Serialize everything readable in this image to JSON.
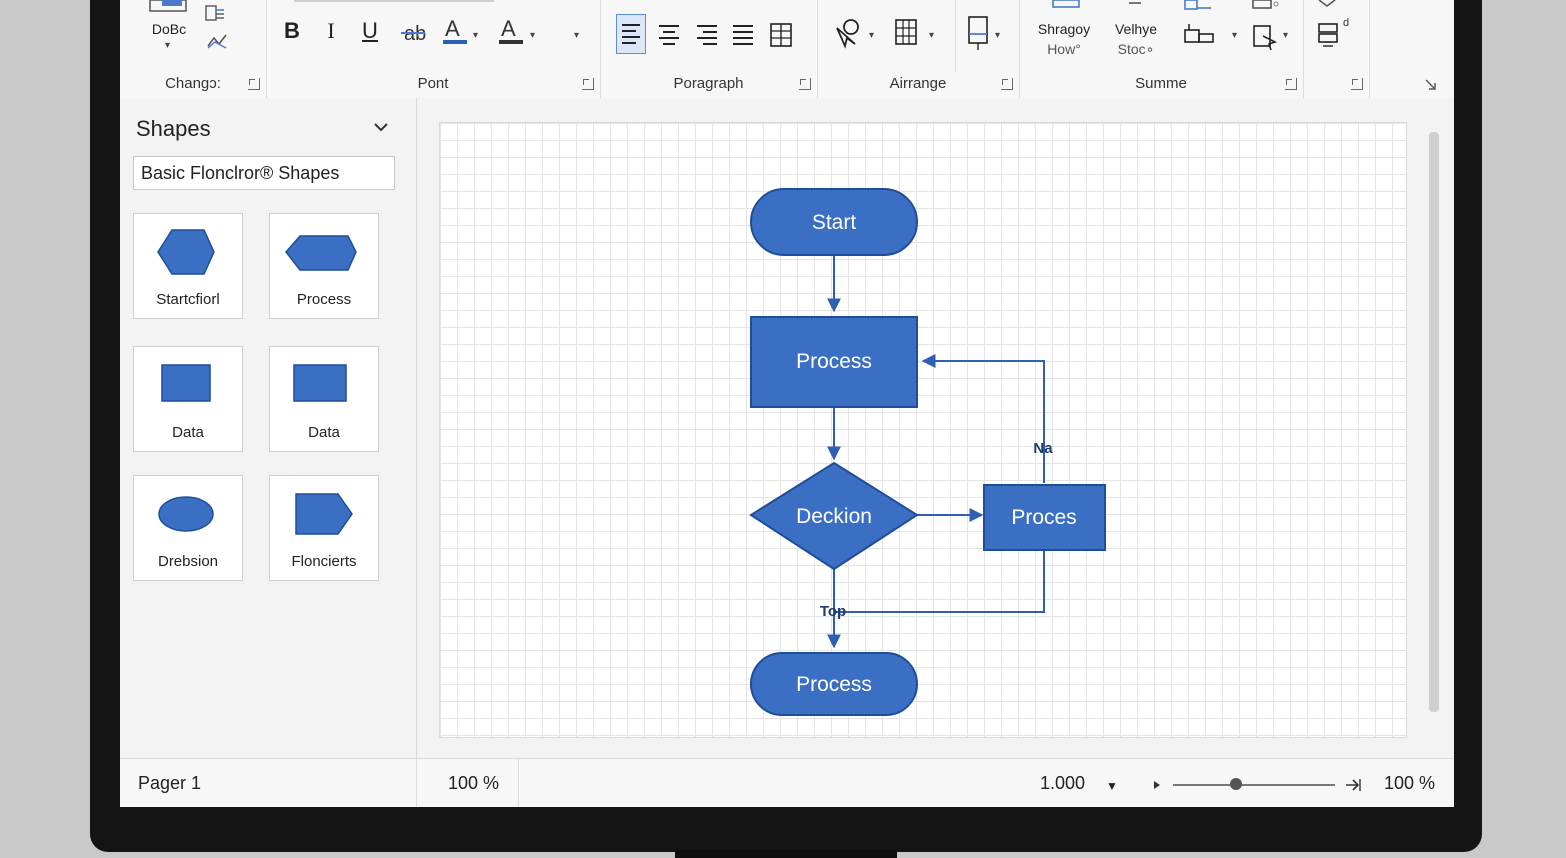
{
  "ribbon": {
    "groups": [
      {
        "label": "Changɔ:"
      },
      {
        "label": "Pont"
      },
      {
        "label": "Poragraph"
      },
      {
        "label": "Airrange"
      },
      {
        "label": "Summe"
      }
    ],
    "buttons": {
      "dobc_label": "DoBc",
      "shragoy_line1": "Shragoy",
      "shragoy_line2": "How°",
      "velhye_line1": "Velhye",
      "velhye_line2": "Stoc∘"
    }
  },
  "shapes_panel": {
    "title": "Shapes",
    "stencil": "Basic Flonclror® Shapes",
    "tiles": [
      {
        "label": "Startcfiorl",
        "shape": "hexagon"
      },
      {
        "label": "Process",
        "shape": "flat-hexagon"
      },
      {
        "label": "Data",
        "shape": "rectangle"
      },
      {
        "label": "Data",
        "shape": "rectangle"
      },
      {
        "label": "Drebsion",
        "shape": "ellipse"
      },
      {
        "label": "Floncierts",
        "shape": "pentagon-arrow"
      }
    ]
  },
  "diagram": {
    "shape_color": "#3a6fc4",
    "shape_border": "#1f4d9a",
    "connector_color": "#2f5fb3",
    "nodes": {
      "start": "Start",
      "process1": "Process",
      "decision": "Deckion",
      "process2": "Proces",
      "end": "Process"
    },
    "edge_labels": {
      "no": "Na",
      "yes": "Top"
    }
  },
  "statusbar": {
    "page": "Pager 1",
    "zoom_left": "100 %",
    "scale": "1.000",
    "zoom_right": "100 %",
    "zoom_slider_level": 0.39
  }
}
